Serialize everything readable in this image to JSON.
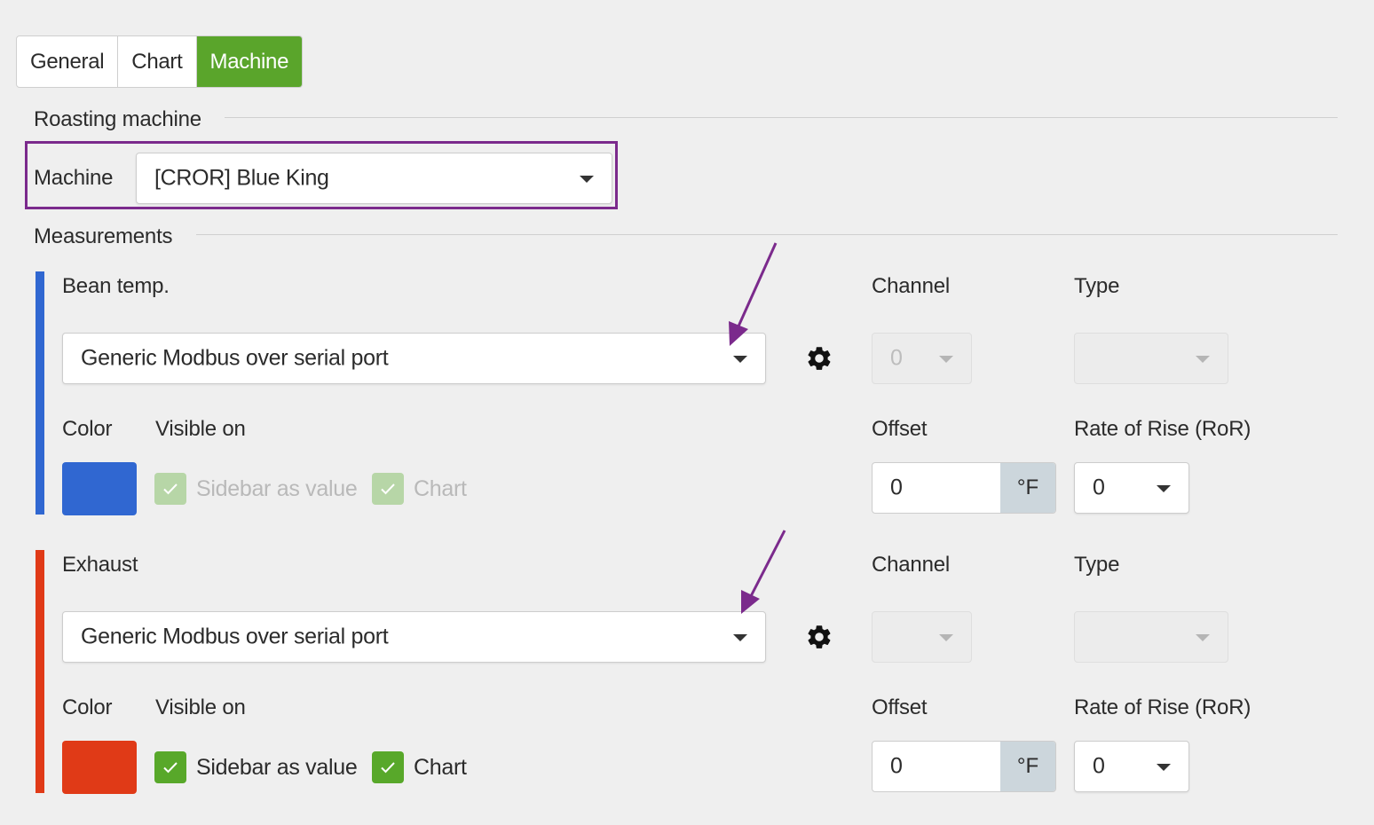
{
  "tabs": [
    {
      "label": "General",
      "active": false
    },
    {
      "label": "Chart",
      "active": false
    },
    {
      "label": "Machine",
      "active": true
    }
  ],
  "sections": {
    "roasting_machine": "Roasting machine",
    "measurements": "Measurements"
  },
  "machine": {
    "label": "Machine",
    "value": "[CROR] Blue King"
  },
  "measurements": [
    {
      "name": "Bean temp.",
      "accent_color": "#3067d1",
      "source": "Generic Modbus over serial port",
      "channel_label": "Channel",
      "channel_value": "0",
      "type_label": "Type",
      "type_value": "",
      "color_label": "Color",
      "visible_on_label": "Visible on",
      "sidebar_label": "Sidebar as value",
      "chart_label": "Chart",
      "sidebar_checked": true,
      "chart_checked": true,
      "checkboxes_disabled": true,
      "offset_label": "Offset",
      "offset_value": "0",
      "offset_unit": "°F",
      "ror_label": "Rate of Rise (RoR)",
      "ror_value": "0"
    },
    {
      "name": "Exhaust",
      "accent_color": "#e03a17",
      "source": "Generic Modbus over serial port",
      "channel_label": "Channel",
      "channel_value": "",
      "type_label": "Type",
      "type_value": "",
      "color_label": "Color",
      "visible_on_label": "Visible on",
      "sidebar_label": "Sidebar as value",
      "chart_label": "Chart",
      "sidebar_checked": true,
      "chart_checked": true,
      "checkboxes_disabled": false,
      "offset_label": "Offset",
      "offset_value": "0",
      "offset_unit": "°F",
      "ror_label": "Rate of Rise (RoR)",
      "ror_value": "0"
    }
  ],
  "annotation_color": "#7b2a8c",
  "icons": {
    "settings": "gear-icon",
    "dropdown": "chevron-down-icon",
    "check": "check-icon",
    "annotation": "arrow-annotation-icon"
  }
}
